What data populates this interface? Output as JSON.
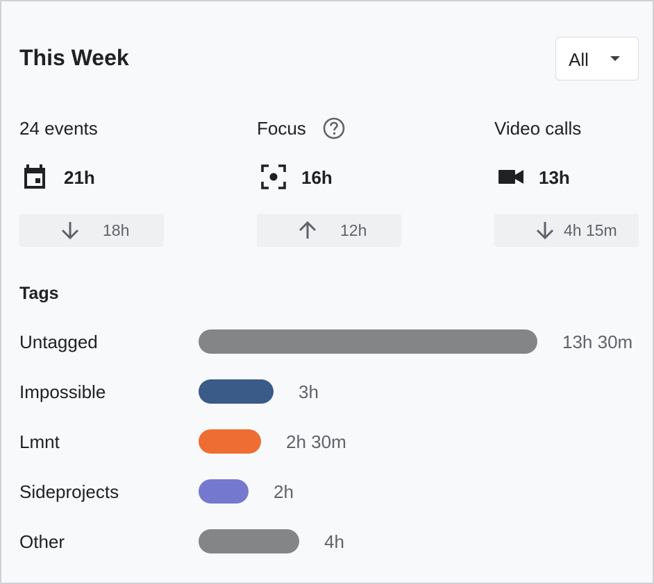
{
  "header": {
    "title": "This Week",
    "filter": {
      "selected": "All"
    }
  },
  "stats": [
    {
      "label": "24 events",
      "icon": "calendar-icon",
      "value": "21h",
      "delta": {
        "direction": "down",
        "icon": "arrow-down-icon",
        "text": "18h"
      }
    },
    {
      "label": "Focus",
      "help_icon": "help-icon",
      "icon": "focus-icon",
      "value": "16h",
      "delta": {
        "direction": "up",
        "icon": "arrow-up-icon",
        "text": "12h"
      }
    },
    {
      "label": "Video calls",
      "icon": "video-camera-icon",
      "value": "13h",
      "delta": {
        "direction": "down",
        "icon": "arrow-down-icon",
        "text": "4h 15m"
      }
    }
  ],
  "tags": {
    "heading": "Tags",
    "items": [
      {
        "name": "Untagged",
        "duration": "13h 30m",
        "hours": 13.5,
        "color": "#848586"
      },
      {
        "name": "Impossible",
        "duration": "3h",
        "hours": 3,
        "color": "#3a5a88"
      },
      {
        "name": "Lmnt",
        "duration": "2h 30m",
        "hours": 2.5,
        "color": "#ee6d32"
      },
      {
        "name": "Sideprojects",
        "duration": "2h",
        "hours": 2,
        "color": "#7479cf"
      },
      {
        "name": "Other",
        "duration": "4h",
        "hours": 4,
        "color": "#848586"
      }
    ]
  }
}
